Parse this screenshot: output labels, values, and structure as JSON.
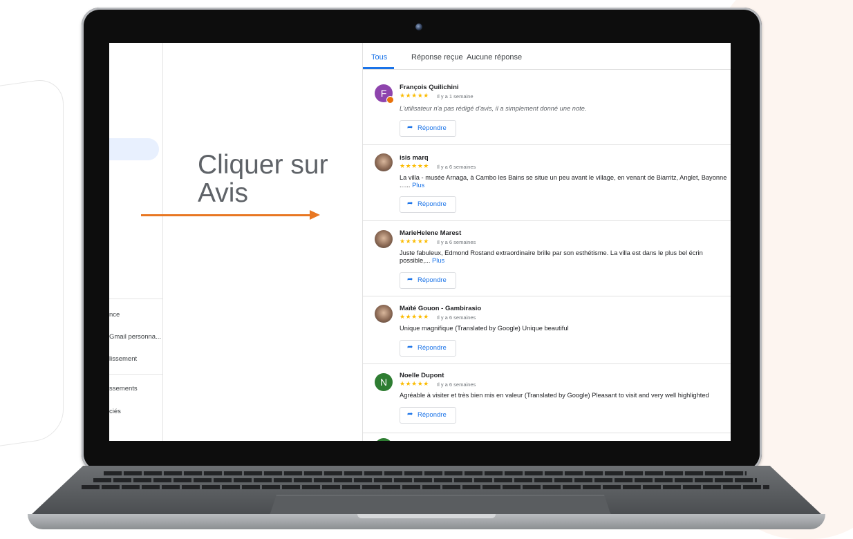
{
  "callout": {
    "line1": "Cliquer sur",
    "line2": "Avis"
  },
  "sidebar": {
    "items": [
      {
        "label": "nce"
      },
      {
        "label": "Gmail personna..."
      },
      {
        "label": "lissement"
      },
      {
        "label": "ssements"
      },
      {
        "label": "ciés"
      }
    ]
  },
  "tabs": [
    {
      "label": "Tous",
      "active": true
    },
    {
      "label": "Réponse reçue"
    },
    {
      "label": "Aucune réponse"
    }
  ],
  "reviews": [
    {
      "name": "François Quilichini",
      "avatar_letter": "F",
      "avatar_color": "#8e44ad",
      "stars": "★★★★★",
      "time": "Il y a 1 semaine",
      "text": "L'utilisateur n'a pas rédigé d'avis, il a simplement donné une note.",
      "reply_label": "Répondre"
    },
    {
      "name": "isis marq",
      "stars": "★★★★★",
      "time": "Il y a 6 semaines",
      "text": "La villa - musée Arnaga, à Cambo les Bains se situe un peu avant le village, en venant de Biarritz, Anglet, Bayonne ......",
      "more": "Plus",
      "reply_label": "Répondre"
    },
    {
      "name": "MarieHelene Marest",
      "stars": "★★★★★",
      "time": "Il y a 6 semaines",
      "text": "Juste fabuleux, Edmond Rostand extraordinaire brille par son esthétisme. La villa est dans le plus bel écrin possible,...",
      "more": "Plus",
      "reply_label": "Répondre"
    },
    {
      "name": "Maïté Gouon - Gambirasio",
      "stars": "★★★★★",
      "time": "Il y a 6 semaines",
      "text": "Unique magnifique (Translated by Google) Unique beautiful",
      "reply_label": "Répondre"
    },
    {
      "name": "Noelle Dupont",
      "avatar_letter": "N",
      "avatar_color": "#2e7d32",
      "stars": "★★★★★",
      "time": "Il y a 6 semaines",
      "text": "Agréable à visiter et très bien mis en valeur (Translated by Google) Pleasant to visit and very well highlighted",
      "reply_label": "Répondre"
    }
  ],
  "colors": {
    "accent": "#1a73e8",
    "arrow": "#e87722",
    "stars": "#fbbc04"
  },
  "icons": {
    "reply": "reply-arrow-icon"
  }
}
